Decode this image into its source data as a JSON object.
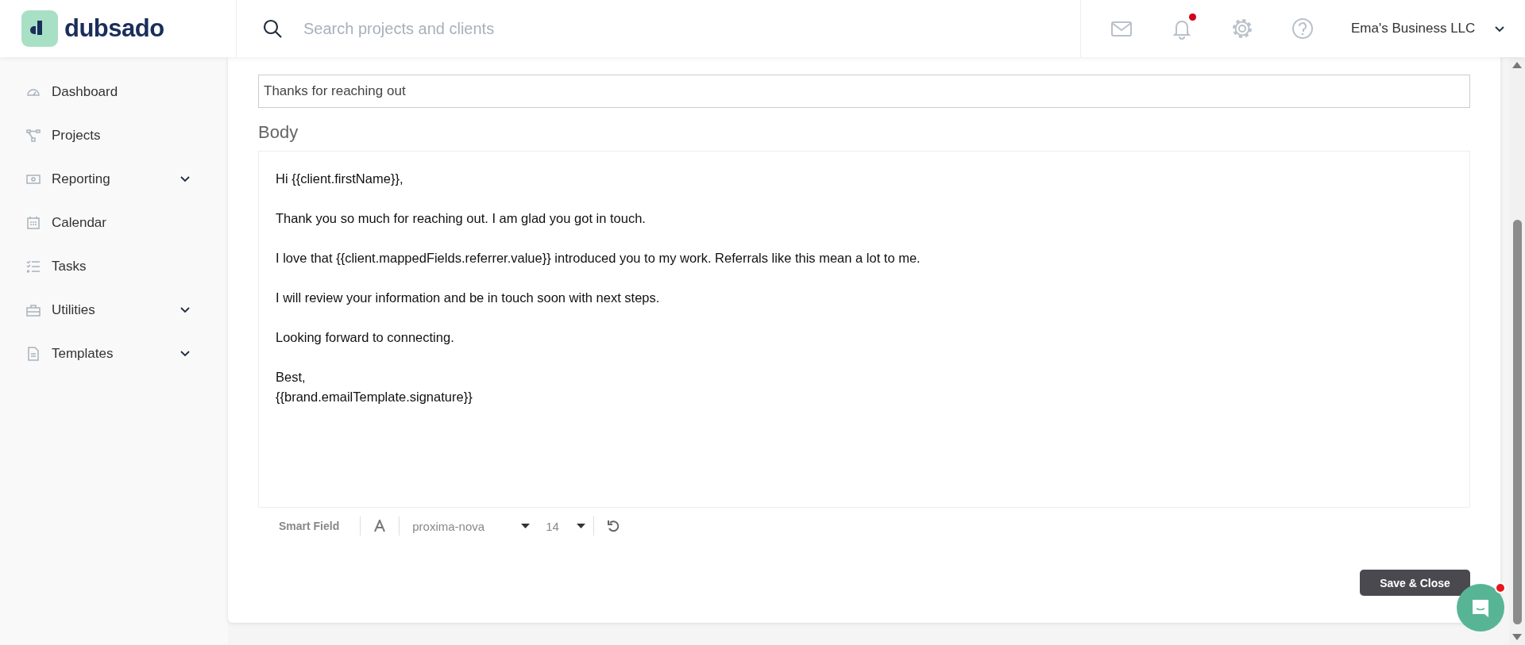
{
  "header": {
    "logo": "dubsado",
    "search": {
      "placeholder": "Search projects and clients"
    },
    "notification_unread": true,
    "account": "Ema's Business LLC"
  },
  "sidebar": {
    "items": [
      {
        "label": "Dashboard",
        "expandable": false
      },
      {
        "label": "Projects",
        "expandable": false
      },
      {
        "label": "Reporting",
        "expandable": true
      },
      {
        "label": "Calendar",
        "expandable": false
      },
      {
        "label": "Tasks",
        "expandable": false
      },
      {
        "label": "Utilities",
        "expandable": true
      },
      {
        "label": "Templates",
        "expandable": true
      }
    ]
  },
  "form": {
    "subject": {
      "value": "Thanks for reaching out"
    },
    "body_label": "Body",
    "body": [
      [
        "Hi {{client.firstName}},"
      ],
      [
        "Thank you so much for reaching out. I am glad you got in touch."
      ],
      [
        "I love that {{client.mappedFields.referrer.value}} introduced you to my work. Referrals like this mean a lot to me."
      ],
      [
        "I will review your information and be in touch soon with next steps."
      ],
      [
        "Looking forward to connecting."
      ],
      [
        "Best,",
        "{{brand.emailTemplate.signature}}"
      ]
    ],
    "toolbar": {
      "smart_field": "Smart Field",
      "font": "proxima-nova",
      "size": "14"
    },
    "save_button": "Save & Close"
  },
  "chat": {
    "unread": true
  }
}
